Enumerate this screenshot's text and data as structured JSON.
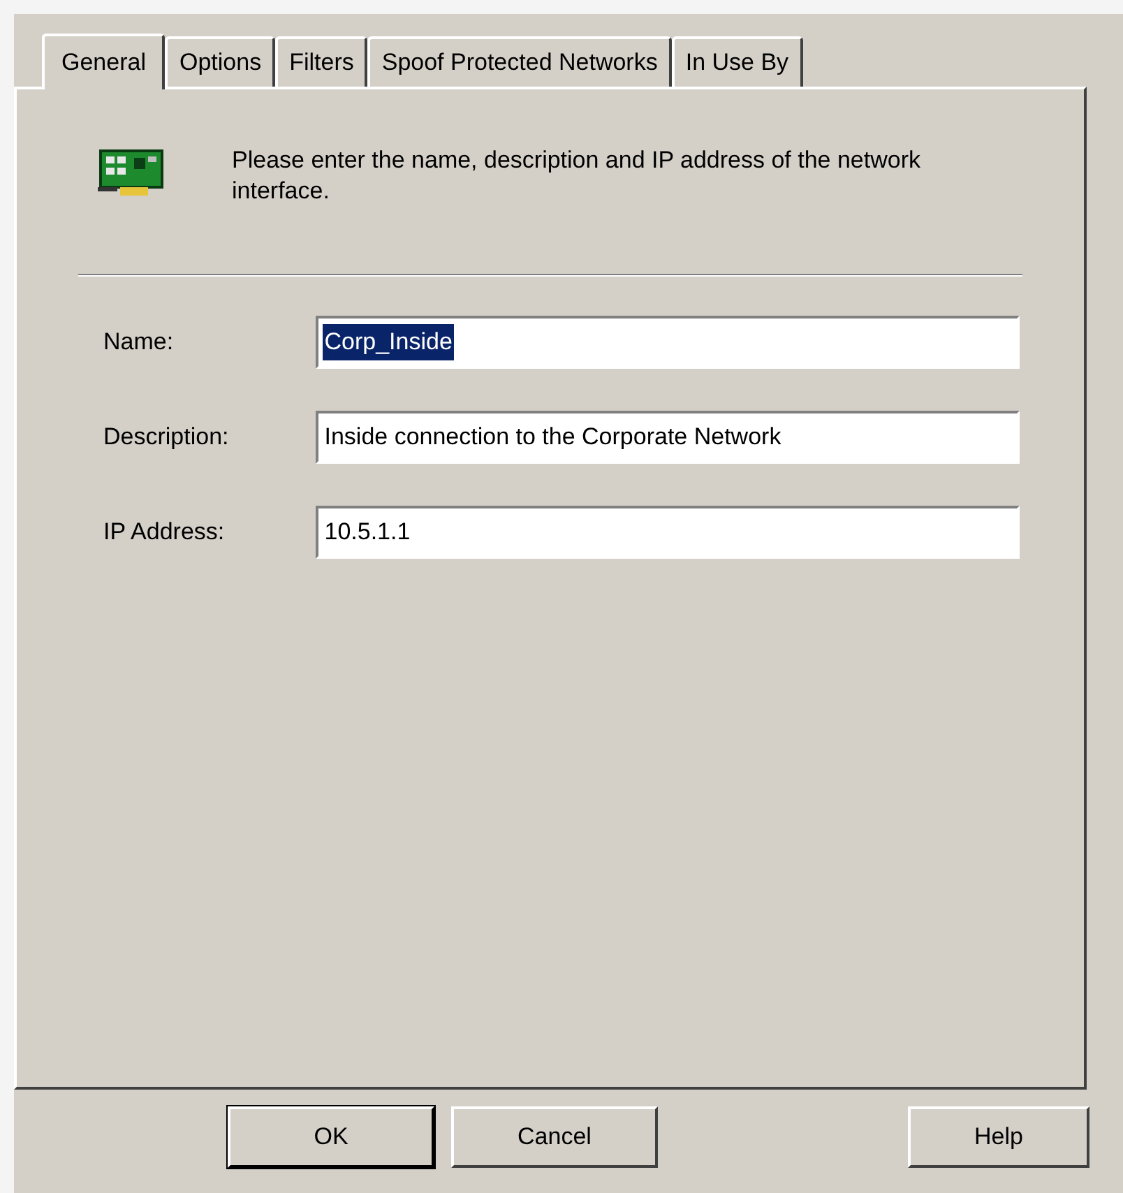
{
  "tabs": [
    {
      "label": "General",
      "selected": true
    },
    {
      "label": "Options",
      "selected": false
    },
    {
      "label": "Filters",
      "selected": false
    },
    {
      "label": "Spoof Protected Networks",
      "selected": false
    },
    {
      "label": "In Use By",
      "selected": false
    }
  ],
  "intro": "Please enter the name, description and IP address of the network interface.",
  "fields": [
    {
      "label": "Name:",
      "value": "Corp_Inside",
      "selected": true
    },
    {
      "label": "Description:",
      "value": "Inside connection to the Corporate Network",
      "selected": false
    },
    {
      "label": "IP Address:",
      "value": "10.5.1.1",
      "selected": false
    }
  ],
  "buttons": [
    {
      "label": "OK",
      "default": true
    },
    {
      "label": "Cancel",
      "default": false
    },
    {
      "label": "Help",
      "default": false
    }
  ]
}
